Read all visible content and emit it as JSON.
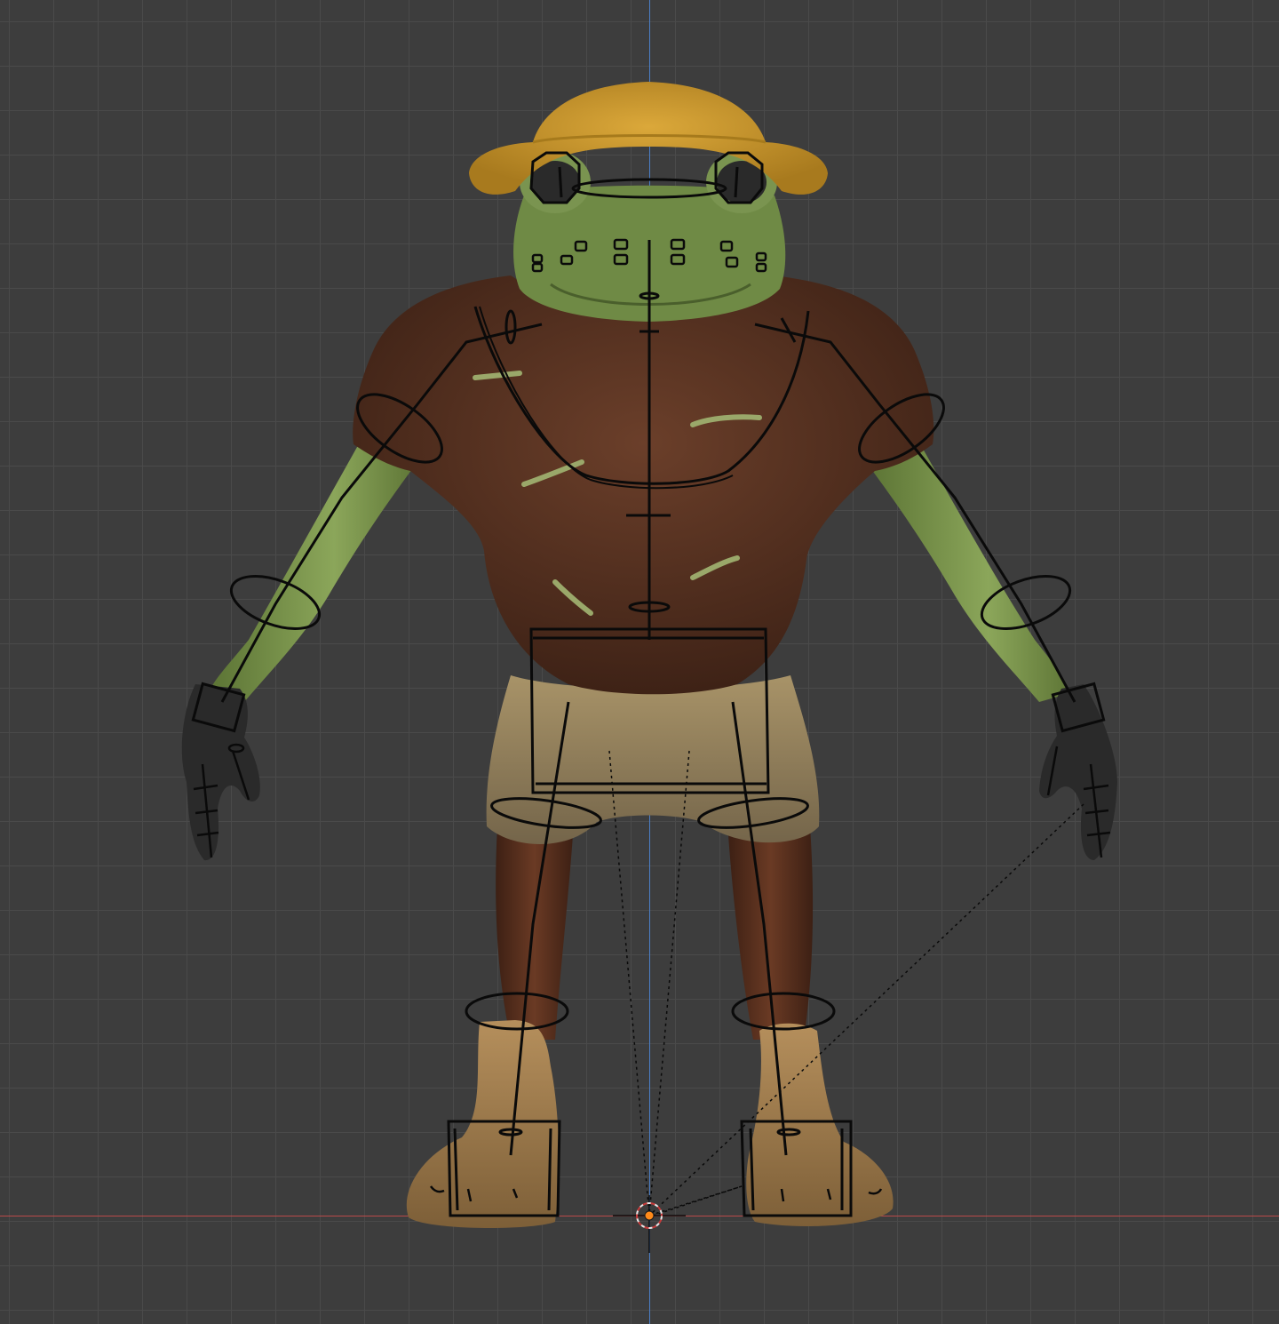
{
  "viewport": {
    "mode": "front-orthographic",
    "background_color": "#3d3d3d",
    "grid_color": "#4a4a4a",
    "x_axis_color": "#b84a4a",
    "y_axis_color": "#4b7fc7"
  },
  "scene": {
    "character": "frog-adventurer-model",
    "armature": "armature-rig-overlay",
    "origin": "world-origin-3d-cursor"
  },
  "colors": {
    "hat": "#c8962a",
    "skin": "#6f8a45",
    "shirt": "#5a3424",
    "shorts": "#8e7d58",
    "boots": "#9c7a4e",
    "gloves": "#2b2b2b",
    "bone_line": "#0a0a0a",
    "cursor": "#ff8a1a"
  }
}
